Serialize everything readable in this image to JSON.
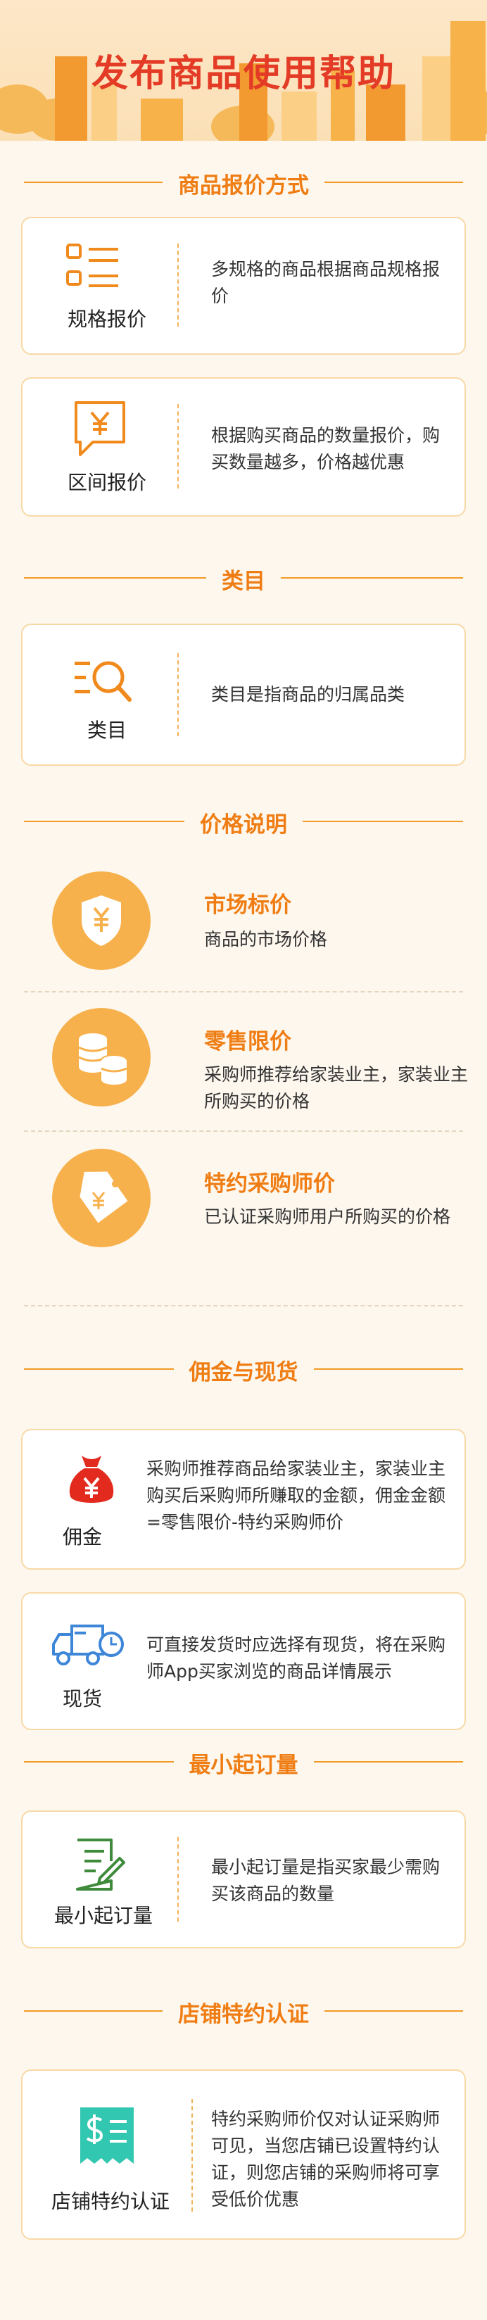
{
  "header": {
    "title": "发布商品使用帮助"
  },
  "sections": {
    "pricing": {
      "heading": "商品报价方式",
      "items": [
        {
          "label": "规格报价",
          "icon": "list-spec-icon",
          "desc": "多规格的商品根据商品规格报价"
        },
        {
          "label": "区间报价",
          "icon": "yen-chat-icon",
          "desc": "根据购买商品的数量报价，购买数量越多，价格越优惠"
        }
      ]
    },
    "category": {
      "heading": "类目",
      "items": [
        {
          "label": "类目",
          "icon": "search-list-icon",
          "desc": "类目是指商品的归属品类"
        }
      ]
    },
    "price_info": {
      "heading": "价格说明",
      "items": [
        {
          "title": "市场标价",
          "icon": "yen-shield-icon",
          "desc": "商品的市场价格"
        },
        {
          "title": "零售限价",
          "icon": "coin-stack-icon",
          "desc": "采购师推荐给家装业主，家装业主所购买的价格"
        },
        {
          "title": "特约采购师价",
          "icon": "price-tag-icon",
          "desc": "已认证采购师用户所购买的价格"
        }
      ]
    },
    "commission": {
      "heading": "佣金与现货",
      "items": [
        {
          "label": "佣金",
          "icon": "money-bag-icon",
          "desc": "采购师推荐商品给家装业主，家装业主购买后采购师所赚取的金额，佣金金额=零售限价-特约采购师价"
        },
        {
          "label": "现货",
          "icon": "delivery-truck-icon",
          "desc": "可直接发货时应选择有现货，将在采购师App买家浏览的商品详情展示"
        }
      ]
    },
    "moq": {
      "heading": "最小起订量",
      "items": [
        {
          "label": "最小起订量",
          "icon": "order-pen-icon",
          "desc": "最小起订量是指买家最少需购买该商品的数量"
        }
      ]
    },
    "store_cert": {
      "heading": "店铺特约认证",
      "items": [
        {
          "label": "店铺特约认证",
          "icon": "dollar-receipt-icon",
          "desc": "特约采购师价仅对认证采购师可见，当您店铺已设置特约认证，则您店铺的采购师将可享受低价优惠"
        }
      ]
    }
  },
  "colors": {
    "accent": "#ef7d13",
    "line": "#f29a24",
    "brand_red": "#e33b25",
    "card_border": "#f8d9a6",
    "teal": "#32c7b0",
    "blue": "#3d86d8",
    "green": "#3f8b3c"
  }
}
